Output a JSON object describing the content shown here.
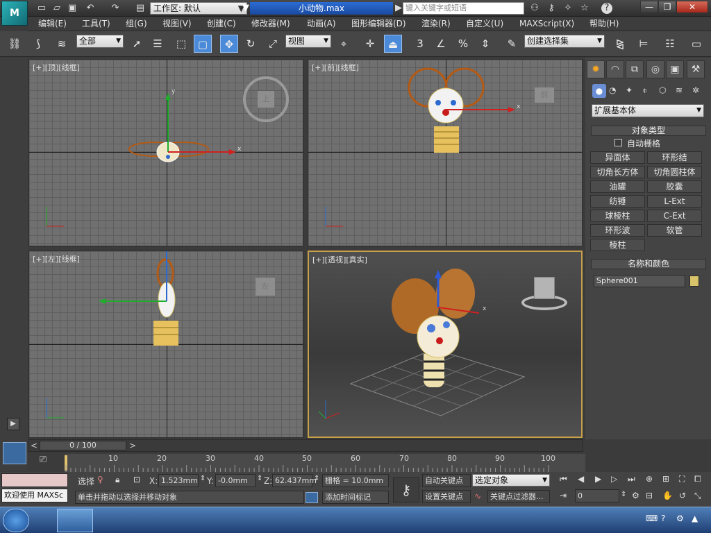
{
  "title_bar": {
    "workspace_label": "工作区: 默认",
    "file_name": "小动物.max",
    "search_placeholder": "键入关键字或短语",
    "icons": [
      "new-file-icon",
      "open-file-icon",
      "save-icon",
      "undo-icon",
      "redo-icon",
      "project-folder-icon",
      "binoculars-icon",
      "key-icon",
      "star-icon",
      "help-icon"
    ]
  },
  "menu": [
    "编辑(E)",
    "工具(T)",
    "组(G)",
    "视图(V)",
    "创建(C)",
    "修改器(M)",
    "动画(A)",
    "图形编辑器(D)",
    "渲染(R)",
    "自定义(U)",
    "MAXScript(X)",
    "帮助(H)"
  ],
  "toolbar": {
    "selection_filter": "全部",
    "ref_coord": "视图",
    "named_selection": "创建选择集",
    "snap_label": "3"
  },
  "viewports": [
    {
      "label": "[+][顶][线框]"
    },
    {
      "label": "[+][前][线框]"
    },
    {
      "label": "[+][左][线框]"
    },
    {
      "label": "[+][透视][真实]"
    }
  ],
  "viewcube": {
    "top": "上",
    "front": "前",
    "left": "左"
  },
  "command_panel": {
    "category": "扩展基本体",
    "object_type_title": "对象类型",
    "auto_grid": "自动栅格",
    "buttons": [
      "异面体",
      "环形结",
      "切角长方体",
      "切角圆柱体",
      "油罐",
      "胶囊",
      "纺锤",
      "L-Ext",
      "球棱柱",
      "C-Ext",
      "环形波",
      "软管",
      "棱柱"
    ],
    "name_color_title": "名称和颜色",
    "object_name": "Sphere001",
    "object_color": "#d8c26a"
  },
  "timeline": {
    "frame_display": "0 / 100",
    "ticks": [
      "10",
      "20",
      "30",
      "40",
      "50",
      "60",
      "70",
      "80",
      "90",
      "100"
    ]
  },
  "status": {
    "script_listener": "欢迎使用 MAXSc",
    "select_label": "选择",
    "x_label": "X:",
    "x_value": "1.523mm",
    "y_label": "Y:",
    "y_value": "-0.0mm",
    "z_label": "Z:",
    "z_value": "62.437mm",
    "grid": "栅格 = 10.0mm",
    "prompt": "单击并拖动以选择并移动对象",
    "add_time_tag": "添加时间标记",
    "auto_key": "自动关键点",
    "set_key": "设置关键点",
    "key_mode": "选定对象",
    "key_filters": "关键点过滤器...",
    "current_frame": "0"
  },
  "colors": {
    "accent": "#4a8ad9",
    "active_viewport_border": "#c8a04a",
    "title_active": "#2b6cd3"
  }
}
